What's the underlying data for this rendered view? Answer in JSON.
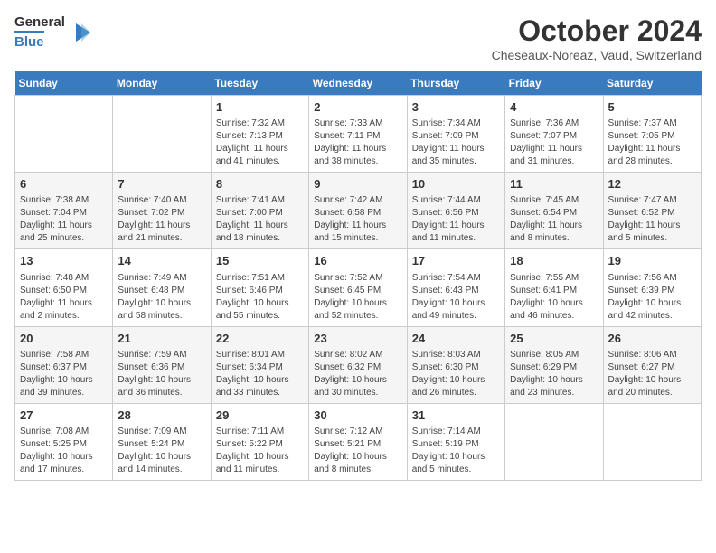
{
  "header": {
    "logo_general": "General",
    "logo_blue": "Blue",
    "month": "October 2024",
    "location": "Cheseaux-Noreaz, Vaud, Switzerland"
  },
  "weekdays": [
    "Sunday",
    "Monday",
    "Tuesday",
    "Wednesday",
    "Thursday",
    "Friday",
    "Saturday"
  ],
  "weeks": [
    [
      {
        "day": "",
        "info": ""
      },
      {
        "day": "",
        "info": ""
      },
      {
        "day": "1",
        "info": "Sunrise: 7:32 AM\nSunset: 7:13 PM\nDaylight: 11 hours and 41 minutes."
      },
      {
        "day": "2",
        "info": "Sunrise: 7:33 AM\nSunset: 7:11 PM\nDaylight: 11 hours and 38 minutes."
      },
      {
        "day": "3",
        "info": "Sunrise: 7:34 AM\nSunset: 7:09 PM\nDaylight: 11 hours and 35 minutes."
      },
      {
        "day": "4",
        "info": "Sunrise: 7:36 AM\nSunset: 7:07 PM\nDaylight: 11 hours and 31 minutes."
      },
      {
        "day": "5",
        "info": "Sunrise: 7:37 AM\nSunset: 7:05 PM\nDaylight: 11 hours and 28 minutes."
      }
    ],
    [
      {
        "day": "6",
        "info": "Sunrise: 7:38 AM\nSunset: 7:04 PM\nDaylight: 11 hours and 25 minutes."
      },
      {
        "day": "7",
        "info": "Sunrise: 7:40 AM\nSunset: 7:02 PM\nDaylight: 11 hours and 21 minutes."
      },
      {
        "day": "8",
        "info": "Sunrise: 7:41 AM\nSunset: 7:00 PM\nDaylight: 11 hours and 18 minutes."
      },
      {
        "day": "9",
        "info": "Sunrise: 7:42 AM\nSunset: 6:58 PM\nDaylight: 11 hours and 15 minutes."
      },
      {
        "day": "10",
        "info": "Sunrise: 7:44 AM\nSunset: 6:56 PM\nDaylight: 11 hours and 11 minutes."
      },
      {
        "day": "11",
        "info": "Sunrise: 7:45 AM\nSunset: 6:54 PM\nDaylight: 11 hours and 8 minutes."
      },
      {
        "day": "12",
        "info": "Sunrise: 7:47 AM\nSunset: 6:52 PM\nDaylight: 11 hours and 5 minutes."
      }
    ],
    [
      {
        "day": "13",
        "info": "Sunrise: 7:48 AM\nSunset: 6:50 PM\nDaylight: 11 hours and 2 minutes."
      },
      {
        "day": "14",
        "info": "Sunrise: 7:49 AM\nSunset: 6:48 PM\nDaylight: 10 hours and 58 minutes."
      },
      {
        "day": "15",
        "info": "Sunrise: 7:51 AM\nSunset: 6:46 PM\nDaylight: 10 hours and 55 minutes."
      },
      {
        "day": "16",
        "info": "Sunrise: 7:52 AM\nSunset: 6:45 PM\nDaylight: 10 hours and 52 minutes."
      },
      {
        "day": "17",
        "info": "Sunrise: 7:54 AM\nSunset: 6:43 PM\nDaylight: 10 hours and 49 minutes."
      },
      {
        "day": "18",
        "info": "Sunrise: 7:55 AM\nSunset: 6:41 PM\nDaylight: 10 hours and 46 minutes."
      },
      {
        "day": "19",
        "info": "Sunrise: 7:56 AM\nSunset: 6:39 PM\nDaylight: 10 hours and 42 minutes."
      }
    ],
    [
      {
        "day": "20",
        "info": "Sunrise: 7:58 AM\nSunset: 6:37 PM\nDaylight: 10 hours and 39 minutes."
      },
      {
        "day": "21",
        "info": "Sunrise: 7:59 AM\nSunset: 6:36 PM\nDaylight: 10 hours and 36 minutes."
      },
      {
        "day": "22",
        "info": "Sunrise: 8:01 AM\nSunset: 6:34 PM\nDaylight: 10 hours and 33 minutes."
      },
      {
        "day": "23",
        "info": "Sunrise: 8:02 AM\nSunset: 6:32 PM\nDaylight: 10 hours and 30 minutes."
      },
      {
        "day": "24",
        "info": "Sunrise: 8:03 AM\nSunset: 6:30 PM\nDaylight: 10 hours and 26 minutes."
      },
      {
        "day": "25",
        "info": "Sunrise: 8:05 AM\nSunset: 6:29 PM\nDaylight: 10 hours and 23 minutes."
      },
      {
        "day": "26",
        "info": "Sunrise: 8:06 AM\nSunset: 6:27 PM\nDaylight: 10 hours and 20 minutes."
      }
    ],
    [
      {
        "day": "27",
        "info": "Sunrise: 7:08 AM\nSunset: 5:25 PM\nDaylight: 10 hours and 17 minutes."
      },
      {
        "day": "28",
        "info": "Sunrise: 7:09 AM\nSunset: 5:24 PM\nDaylight: 10 hours and 14 minutes."
      },
      {
        "day": "29",
        "info": "Sunrise: 7:11 AM\nSunset: 5:22 PM\nDaylight: 10 hours and 11 minutes."
      },
      {
        "day": "30",
        "info": "Sunrise: 7:12 AM\nSunset: 5:21 PM\nDaylight: 10 hours and 8 minutes."
      },
      {
        "day": "31",
        "info": "Sunrise: 7:14 AM\nSunset: 5:19 PM\nDaylight: 10 hours and 5 minutes."
      },
      {
        "day": "",
        "info": ""
      },
      {
        "day": "",
        "info": ""
      }
    ]
  ]
}
